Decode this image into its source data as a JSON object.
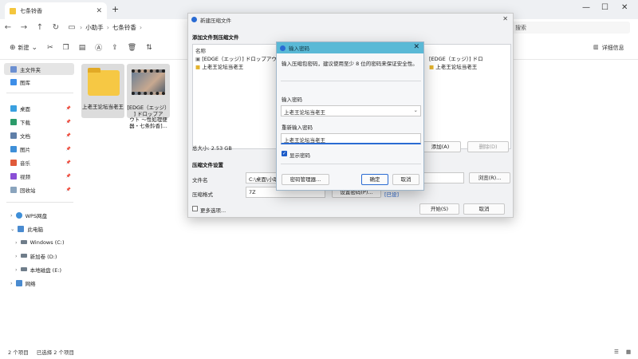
{
  "explorer": {
    "tab_title": "七条铃香",
    "close_glyph": "✕",
    "new_tab_glyph": "+",
    "window_controls": [
      "—",
      "☐",
      "✕"
    ],
    "breadcrumbs": [
      "小助手",
      "七条铃香"
    ],
    "search_placeholder": "搜索",
    "toolbar": {
      "new_label": "新建",
      "details_label": "详细信息"
    },
    "sidebar": {
      "pinned": [
        {
          "label": "主文件夹",
          "icon": "home-icon"
        },
        {
          "label": "图库",
          "icon": "gallery-icon"
        },
        {
          "label": "桌面",
          "icon": "desktop-icon"
        },
        {
          "label": "下载",
          "icon": "download-icon"
        },
        {
          "label": "文档",
          "icon": "document-icon"
        },
        {
          "label": "图片",
          "icon": "pictures-icon"
        },
        {
          "label": "音乐",
          "icon": "music-icon"
        },
        {
          "label": "视频",
          "icon": "video-icon"
        },
        {
          "label": "回收站",
          "icon": "recycle-bin-icon"
        }
      ],
      "tree": [
        {
          "label": "WPS网盘",
          "icon": "cloud-icon"
        },
        {
          "label": "此电脑",
          "icon": "pc-icon"
        },
        {
          "label": "Windows (C:)",
          "icon": "drive-icon"
        },
        {
          "label": "新加卷 (D:)",
          "icon": "drive-icon"
        },
        {
          "label": "本地磁盘 (E:)",
          "icon": "drive-icon"
        },
        {
          "label": "网络",
          "icon": "network-icon"
        }
      ]
    },
    "files": [
      {
        "name": "上老王论坛当老王",
        "type": "folder"
      },
      {
        "name_lines": [
          "[EDGE（エッジ）",
          "] ドロップア",
          "ウト ～性処理便",
          "器・七条鈴香]..."
        ],
        "type": "video"
      }
    ],
    "status": {
      "count": "2 个项目",
      "selected": "已选择 2 个项目"
    }
  },
  "compress_dialog": {
    "title": "新建压缩文件",
    "section_add": "添加文件到压缩文件",
    "list_header": "名称",
    "list_items": [
      "[EDGE（エッジ）] ドロップアウト",
      "上老王论坛当老王"
    ],
    "right_items": [
      "[EDGE（エッジ）] ドロ",
      "上老王论坛当老王"
    ],
    "total_size": "总大小: 2.53 GB",
    "add_button": "添加(A)",
    "delete_button": "删除(D)",
    "section_settings": "压缩文件设置",
    "filename_label": "文件名",
    "filename_value": "C:\\桌面\\小助",
    "browse_button": "浏览(R)...",
    "format_label": "压缩格式",
    "format_value": "7Z",
    "setpwd_button": "设置密码(P)...",
    "pwd_status": "[已设]",
    "more_options": "更多选项...",
    "start_button": "开始(S)",
    "cancel_button": "取消"
  },
  "password_dialog": {
    "title": "输入密码",
    "hint": "输入压缩包密码，建议使用至少 8 位的密码来保证安全性。",
    "enter_label": "输入密码",
    "enter_value": "上老王论坛当老王",
    "reenter_label": "重新输入密码",
    "reenter_value": "上老王论坛当老王",
    "show_password": "显示密码",
    "manager_button": "密码管理器...",
    "ok_button": "确定",
    "cancel_button": "取消"
  }
}
